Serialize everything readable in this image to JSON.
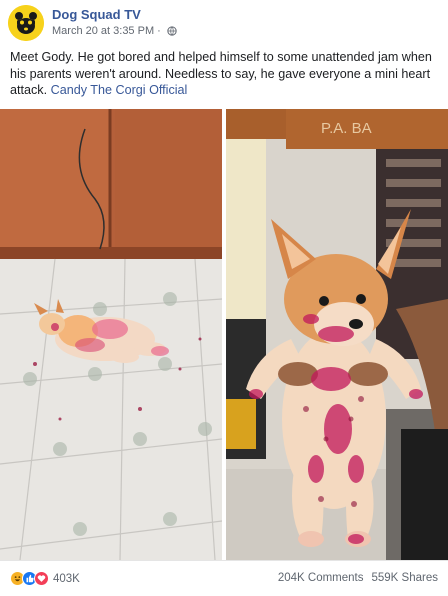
{
  "post": {
    "page_name": "Dog Squad TV",
    "timestamp": "March 20 at 3:35 PM",
    "separator": "·",
    "privacy_icon": "globe-icon",
    "caption_text": "Meet Gody. He got bored and helped himself to some unattended jam when his parents weren't around. Needless to say, he gave everyone a mini heart attack.",
    "caption_tag": "Candy The Corgi Official",
    "colors": {
      "link": "#385898",
      "meta": "#616770",
      "avatar_bg": "#f7d21b"
    }
  },
  "photos": {
    "left_icon": "photo-floor-corgi",
    "right_icon": "photo-held-corgi",
    "right_sign_text": "P.A. BA"
  },
  "footer": {
    "reaction_icons": [
      "haha-icon",
      "like-icon",
      "love-icon"
    ],
    "reaction_count": "403K",
    "comments": "204K Comments",
    "shares": "559K Shares"
  }
}
